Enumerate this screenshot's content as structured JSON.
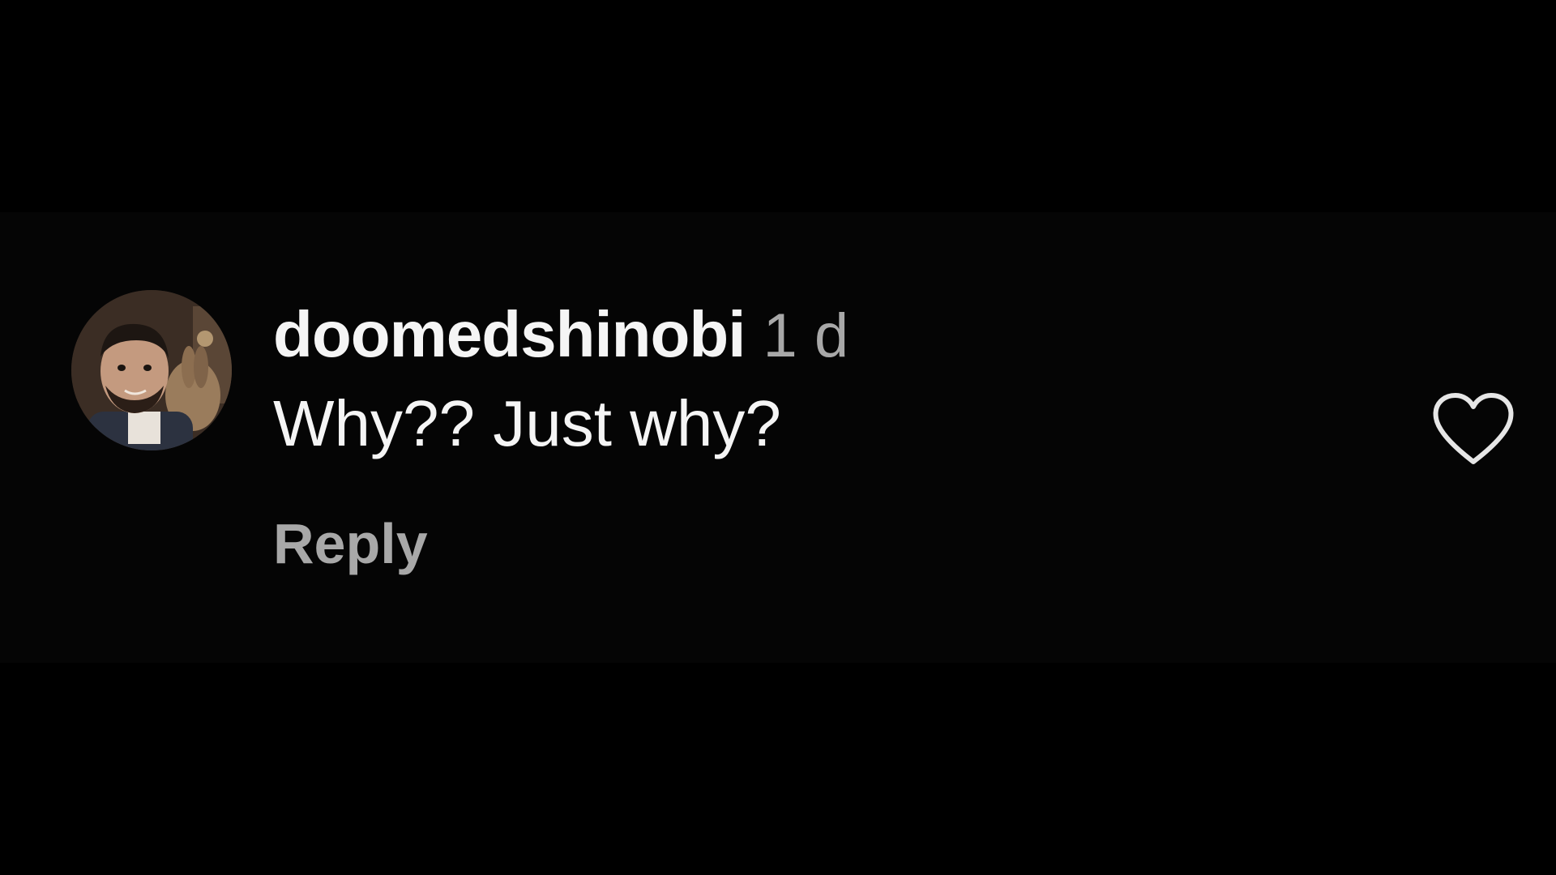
{
  "comment": {
    "username": "doomedshinobi",
    "timestamp": "1 d",
    "text": "Why?? Just why?",
    "reply_label": "Reply"
  },
  "icons": {
    "like": "heart-outline-icon",
    "avatar": "user-avatar"
  },
  "colors": {
    "background": "#000000",
    "comment_band": "#050505",
    "username": "#f5f5f5",
    "text": "#f5f5f5",
    "secondary": "#a8a8a8",
    "icon": "#e6e6e6"
  }
}
